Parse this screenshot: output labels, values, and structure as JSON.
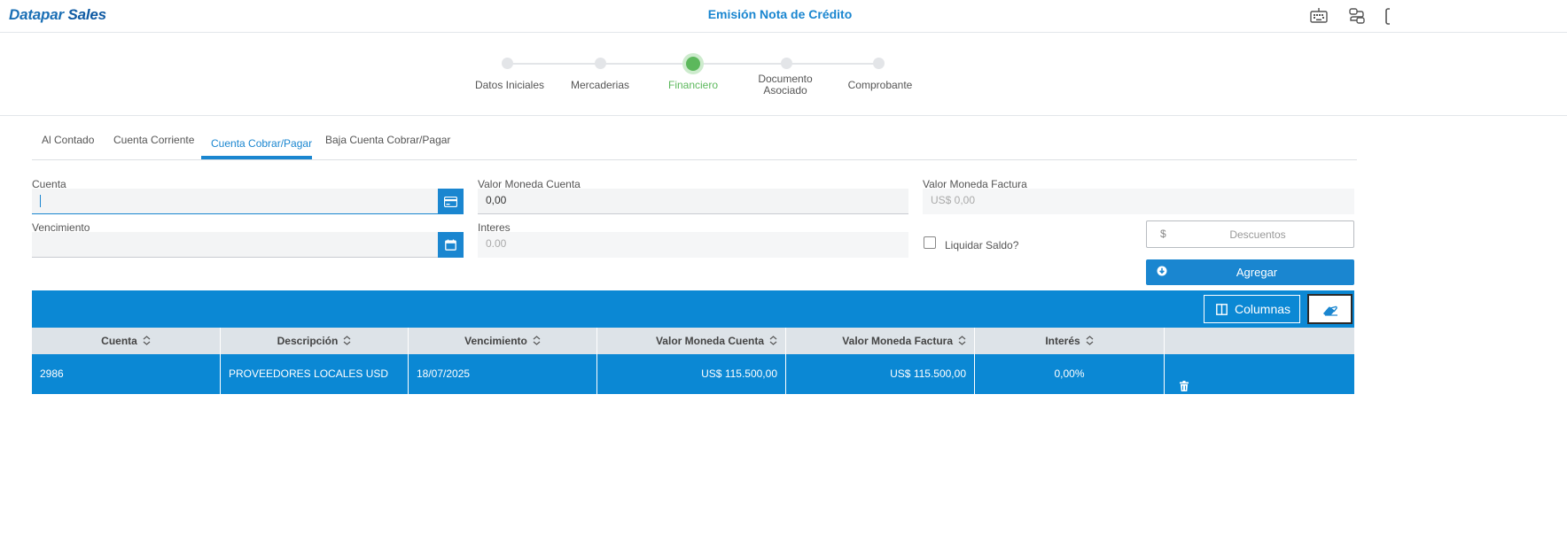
{
  "app": {
    "logo_part1": "Datapar",
    "logo_part2": "Sales",
    "title": "Emisión Nota de Crédito"
  },
  "header_icons": [
    "keyboard-icon",
    "routing-icon",
    "tablet-icon"
  ],
  "stepper": {
    "steps": [
      {
        "label": "Datos Iniciales"
      },
      {
        "label": "Mercaderias"
      },
      {
        "label": "Financiero"
      },
      {
        "label": "Documento Asociado"
      },
      {
        "label": "Comprobante"
      }
    ],
    "active": "Financiero",
    "active_color": "#5cb85c"
  },
  "tabs": {
    "items": [
      {
        "label": "Al Contado"
      },
      {
        "label": "Cuenta Corriente"
      },
      {
        "label": "Cuenta Cobrar/Pagar"
      },
      {
        "label": "Baja Cuenta Cobrar/Pagar"
      }
    ],
    "active": "Cuenta Cobrar/Pagar"
  },
  "form": {
    "cuenta": {
      "label": "Cuenta",
      "value": ""
    },
    "valor_moneda_cuenta": {
      "label": "Valor Moneda Cuenta",
      "value": "0,00"
    },
    "valor_moneda_factura": {
      "label": "Valor Moneda Factura",
      "value": "US$ 0,00"
    },
    "vencimiento": {
      "label": "Vencimiento",
      "value": ""
    },
    "interes": {
      "label": "Interes",
      "value": "0.00"
    },
    "liquidar_saldo": {
      "label": "Liquidar Saldo?",
      "checked": false
    },
    "descuentos": {
      "symbol": "$",
      "placeholder": "Descuentos"
    },
    "agregar": {
      "label": "Agregar"
    }
  },
  "grid": {
    "toolbar": {
      "columns_label": "Columnas"
    },
    "columns": [
      "Cuenta",
      "Descripción",
      "Vencimiento",
      "Valor Moneda Cuenta",
      "Valor Moneda Factura",
      "Interés"
    ],
    "rows": [
      {
        "cuenta": "2986",
        "descripcion": "PROVEEDORES LOCALES USD",
        "vencimiento": "18/07/2025",
        "valor_moneda_cuenta": "US$ 115.500,00",
        "valor_moneda_factura": "US$ 115.500,00",
        "interes": "0,00%"
      }
    ]
  },
  "colors": {
    "primary": "#1a86d0",
    "grid_blue": "#0b88d4",
    "header_gray": "#dde3e8"
  }
}
